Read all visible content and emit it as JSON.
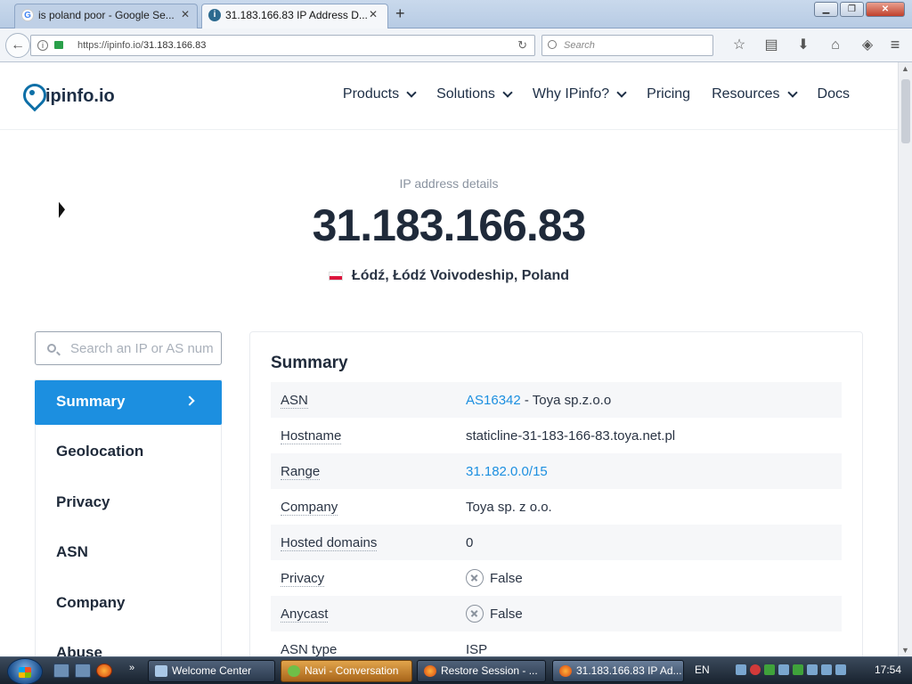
{
  "browser": {
    "tabs": [
      {
        "title": "is poland poor - Google Se...",
        "icon": "google-g-icon",
        "icon_glyph": "G"
      },
      {
        "title": "31.183.166.83 IP Address D...",
        "icon": "ipinfo-pin-icon",
        "icon_glyph": "i"
      }
    ],
    "url_prefix": "https://ipinfo.io/",
    "url_path": "31.183.166.83",
    "search_placeholder": "Search"
  },
  "site": {
    "logo_text": "ipinfo.io",
    "nav": [
      {
        "label": "Products",
        "has_dropdown": true
      },
      {
        "label": "Solutions",
        "has_dropdown": true
      },
      {
        "label": "Why IPinfo?",
        "has_dropdown": true
      },
      {
        "label": "Pricing",
        "has_dropdown": false
      },
      {
        "label": "Resources",
        "has_dropdown": true
      },
      {
        "label": "Docs",
        "has_dropdown": false
      }
    ]
  },
  "hero": {
    "subtitle": "IP address details",
    "ip": "31.183.166.83",
    "location": "Łódź, Łódź Voivodeship, Poland",
    "flag_colors": [
      "#ffffff",
      "#dc143c"
    ]
  },
  "sidebar": {
    "search_placeholder": "Search an IP or AS number",
    "items": [
      "Summary",
      "Geolocation",
      "Privacy",
      "ASN",
      "Company",
      "Abuse"
    ],
    "active_index": 0
  },
  "summary": {
    "title": "Summary",
    "rows": [
      {
        "key": "ASN",
        "link": "AS16342",
        "text": " - Toya sp.z.o.o"
      },
      {
        "key": "Hostname",
        "text": "staticline-31-183-166-83.toya.net.pl"
      },
      {
        "key": "Range",
        "link": "31.182.0.0/15"
      },
      {
        "key": "Company",
        "text": "Toya sp. z o.o."
      },
      {
        "key": "Hosted domains",
        "text": "0"
      },
      {
        "key": "Privacy",
        "icon": "x-circle-icon",
        "text": "False"
      },
      {
        "key": "Anycast",
        "icon": "x-circle-icon",
        "text": "False"
      },
      {
        "key": "ASN type",
        "text": "ISP"
      }
    ]
  },
  "colors": {
    "accent": "#1c8fe0",
    "logo": "#0d6fa7",
    "text_dark": "#1f2a3a"
  },
  "taskbar": {
    "buttons": [
      "Welcome Center",
      "Navi - Conversation",
      "Restore Session - ...",
      "31.183.166.83 IP Ad..."
    ],
    "language": "EN",
    "clock": "17:54"
  }
}
